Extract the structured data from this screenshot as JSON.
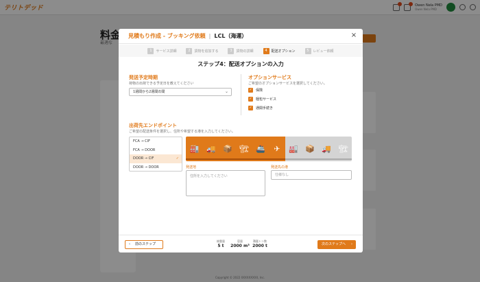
{
  "app": {
    "logo": "テリトデッド"
  },
  "user": {
    "name": "Owen Nela PMD",
    "sub": "Owen Nela PMD"
  },
  "background": {
    "title_fragment": "料金",
    "subtitle_fragment": "最適な",
    "footer": "Copyright © 2022 XXXXXXXXX, Inc."
  },
  "modal": {
    "title": "見積もり作成 - ブッキング依頼",
    "title_sep": "|",
    "mode": "LCL（海運）",
    "close": "×",
    "steps": [
      {
        "num": "1",
        "label": "サービス詳細"
      },
      {
        "num": "2",
        "label": "貨物を追加する"
      },
      {
        "num": "3",
        "label": "貨物の詳細"
      },
      {
        "num": "4",
        "label": "配送オプション"
      },
      {
        "num": "5",
        "label": "レビュー依頼"
      }
    ],
    "step_heading": "ステップ4：配送オプションの入力",
    "shipping_period": {
      "title": "発送予定時期",
      "desc": "荷物の出荷できる予定日を教えてください",
      "value": "1週間から2週間の間",
      "chevron": "⌄"
    },
    "option_service": {
      "title": "オプションサービス",
      "desc": "ご希望のオプションサービスを選択してください。",
      "options": [
        {
          "label": "保険",
          "check": "✓"
        },
        {
          "label": "梱包サービス",
          "check": "✓"
        },
        {
          "label": "通関手続き",
          "check": "✓"
        }
      ]
    },
    "endpoint": {
      "title": "出荷先エンドポイント",
      "desc": "ご希望の配送条件を選択し、住所や希望する港を入力してください。",
      "items": [
        "FCA → CIF",
        "FCA → DOOR",
        "DOOR → CIF",
        "DOOR → DOOR"
      ],
      "selected_check": "✓",
      "origin_label": "発送地",
      "origin_placeholder": "住所を入力してください",
      "dest_label": "発送先の港",
      "dest_placeholder": "仕様なし"
    },
    "process_icons": [
      "🏭",
      "🚚",
      "📦",
      "🏗",
      "🚢",
      "✈",
      "🏭",
      "📦",
      "🚚",
      "🏗"
    ],
    "colors": {
      "accent": "#e07a1a",
      "inactive": "#c8c8c8"
    },
    "footer": {
      "back": "前のステップ",
      "back_icon": "‹",
      "next": "次のステップへ",
      "next_icon": "›",
      "summary": [
        {
          "label": "総重量",
          "value": "5 t"
        },
        {
          "label": "容量",
          "value": "2000 m³"
        },
        {
          "label": "積載トン数",
          "value": "2000 t"
        }
      ]
    }
  }
}
